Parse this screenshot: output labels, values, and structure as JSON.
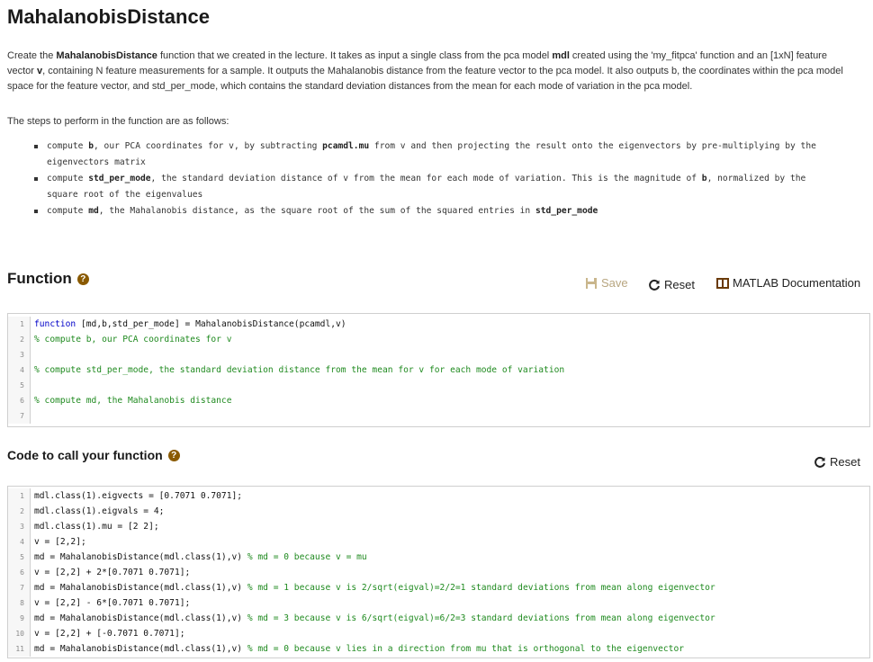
{
  "page": {
    "title": "MahalanobisDistance",
    "desc_html_parts": {
      "p1": "Create the ",
      "fn": "MahalanobisDistance",
      "p2": " function that we created in the lecture. It takes as input a single class from the pca model ",
      "mdl": "mdl",
      "p3": " created using the 'my_fitpca' function and an [1xN] feature vector ",
      "v": "v",
      "p4": ", containing N feature measurements for a sample. It outputs the Mahalanobis distance from the feature vector to the pca model. It also outputs b, the coordinates within the pca model space for the feature vector, and std_per_mode, which contains the standard deviation distances from the mean for each mode of variation in the pca model."
    },
    "steps_intro": "The steps to perform in the function are as follows:",
    "steps": [
      {
        "a": "compute ",
        "b1": "b",
        "c": ", our PCA coordinates for v, by subtracting ",
        "b2": "pcamdl.mu",
        "d": " from v and then projecting the result onto the eigenvectors by pre-multiplying by the eigenvectors matrix"
      },
      {
        "a": "compute ",
        "b1": "std_per_mode",
        "c": ", the standard deviation distance of v from the mean for each mode of variation. This is the magnitude of ",
        "b2": "b",
        "d": ", normalized by the square root of the eigenvalues"
      },
      {
        "a": "compute ",
        "b1": "md",
        "c": ", the Mahalanobis distance, as the square root of the sum of the squared entries in ",
        "b2": "std_per_mode",
        "d": ""
      }
    ]
  },
  "function_section": {
    "heading": "Function",
    "help_icon": "?",
    "save_label": "Save",
    "reset_label": "Reset",
    "doc_label": "MATLAB Documentation",
    "lines": [
      {
        "n": "1",
        "kw": "function",
        "text": " [md,b,std_per_mode] = MahalanobisDistance(pcamdl,v)",
        "cm": ""
      },
      {
        "n": "2",
        "kw": "",
        "text": "",
        "cm": "% compute b, our PCA coordinates for v"
      },
      {
        "n": "3",
        "kw": "",
        "text": "",
        "cm": ""
      },
      {
        "n": "4",
        "kw": "",
        "text": "",
        "cm": "% compute std_per_mode, the standard deviation distance from the mean for v for each mode of variation"
      },
      {
        "n": "5",
        "kw": "",
        "text": "",
        "cm": ""
      },
      {
        "n": "6",
        "kw": "",
        "text": "",
        "cm": "% compute md, the Mahalanobis distance"
      },
      {
        "n": "7",
        "kw": "",
        "text": "",
        "cm": ""
      }
    ]
  },
  "call_section": {
    "heading": "Code to call your function",
    "help_icon": "?",
    "reset_label": "Reset",
    "lines": [
      {
        "n": "1",
        "text": "mdl.class(1).eigvects = [0.7071 0.7071];",
        "cm": ""
      },
      {
        "n": "2",
        "text": "mdl.class(1).eigvals = 4;",
        "cm": ""
      },
      {
        "n": "3",
        "text": "mdl.class(1).mu = [2 2];",
        "cm": ""
      },
      {
        "n": "4",
        "text": "v = [2,2];",
        "cm": ""
      },
      {
        "n": "5",
        "text": "md = MahalanobisDistance(mdl.class(1),v) ",
        "cm": "% md = 0 because v = mu"
      },
      {
        "n": "6",
        "text": "v = [2,2] + 2*[0.7071 0.7071];",
        "cm": ""
      },
      {
        "n": "7",
        "text": "md = MahalanobisDistance(mdl.class(1),v) ",
        "cm": "% md = 1 because v is 2/sqrt(eigval)=2/2=1 standard deviations from mean along eigenvector"
      },
      {
        "n": "8",
        "text": "v = [2,2] - 6*[0.7071 0.7071];",
        "cm": ""
      },
      {
        "n": "9",
        "text": "md = MahalanobisDistance(mdl.class(1),v) ",
        "cm": "% md = 3 because v is 6/sqrt(eigval)=6/2=3 standard deviations from mean along eigenvector"
      },
      {
        "n": "10",
        "text": "v = [2,2] + [-0.7071 0.7071];",
        "cm": ""
      },
      {
        "n": "11",
        "text": "md = MahalanobisDistance(mdl.class(1),v) ",
        "cm": "% md = 0 because v lies in a direction from mu that is orthogonal to the eigenvector"
      }
    ]
  }
}
